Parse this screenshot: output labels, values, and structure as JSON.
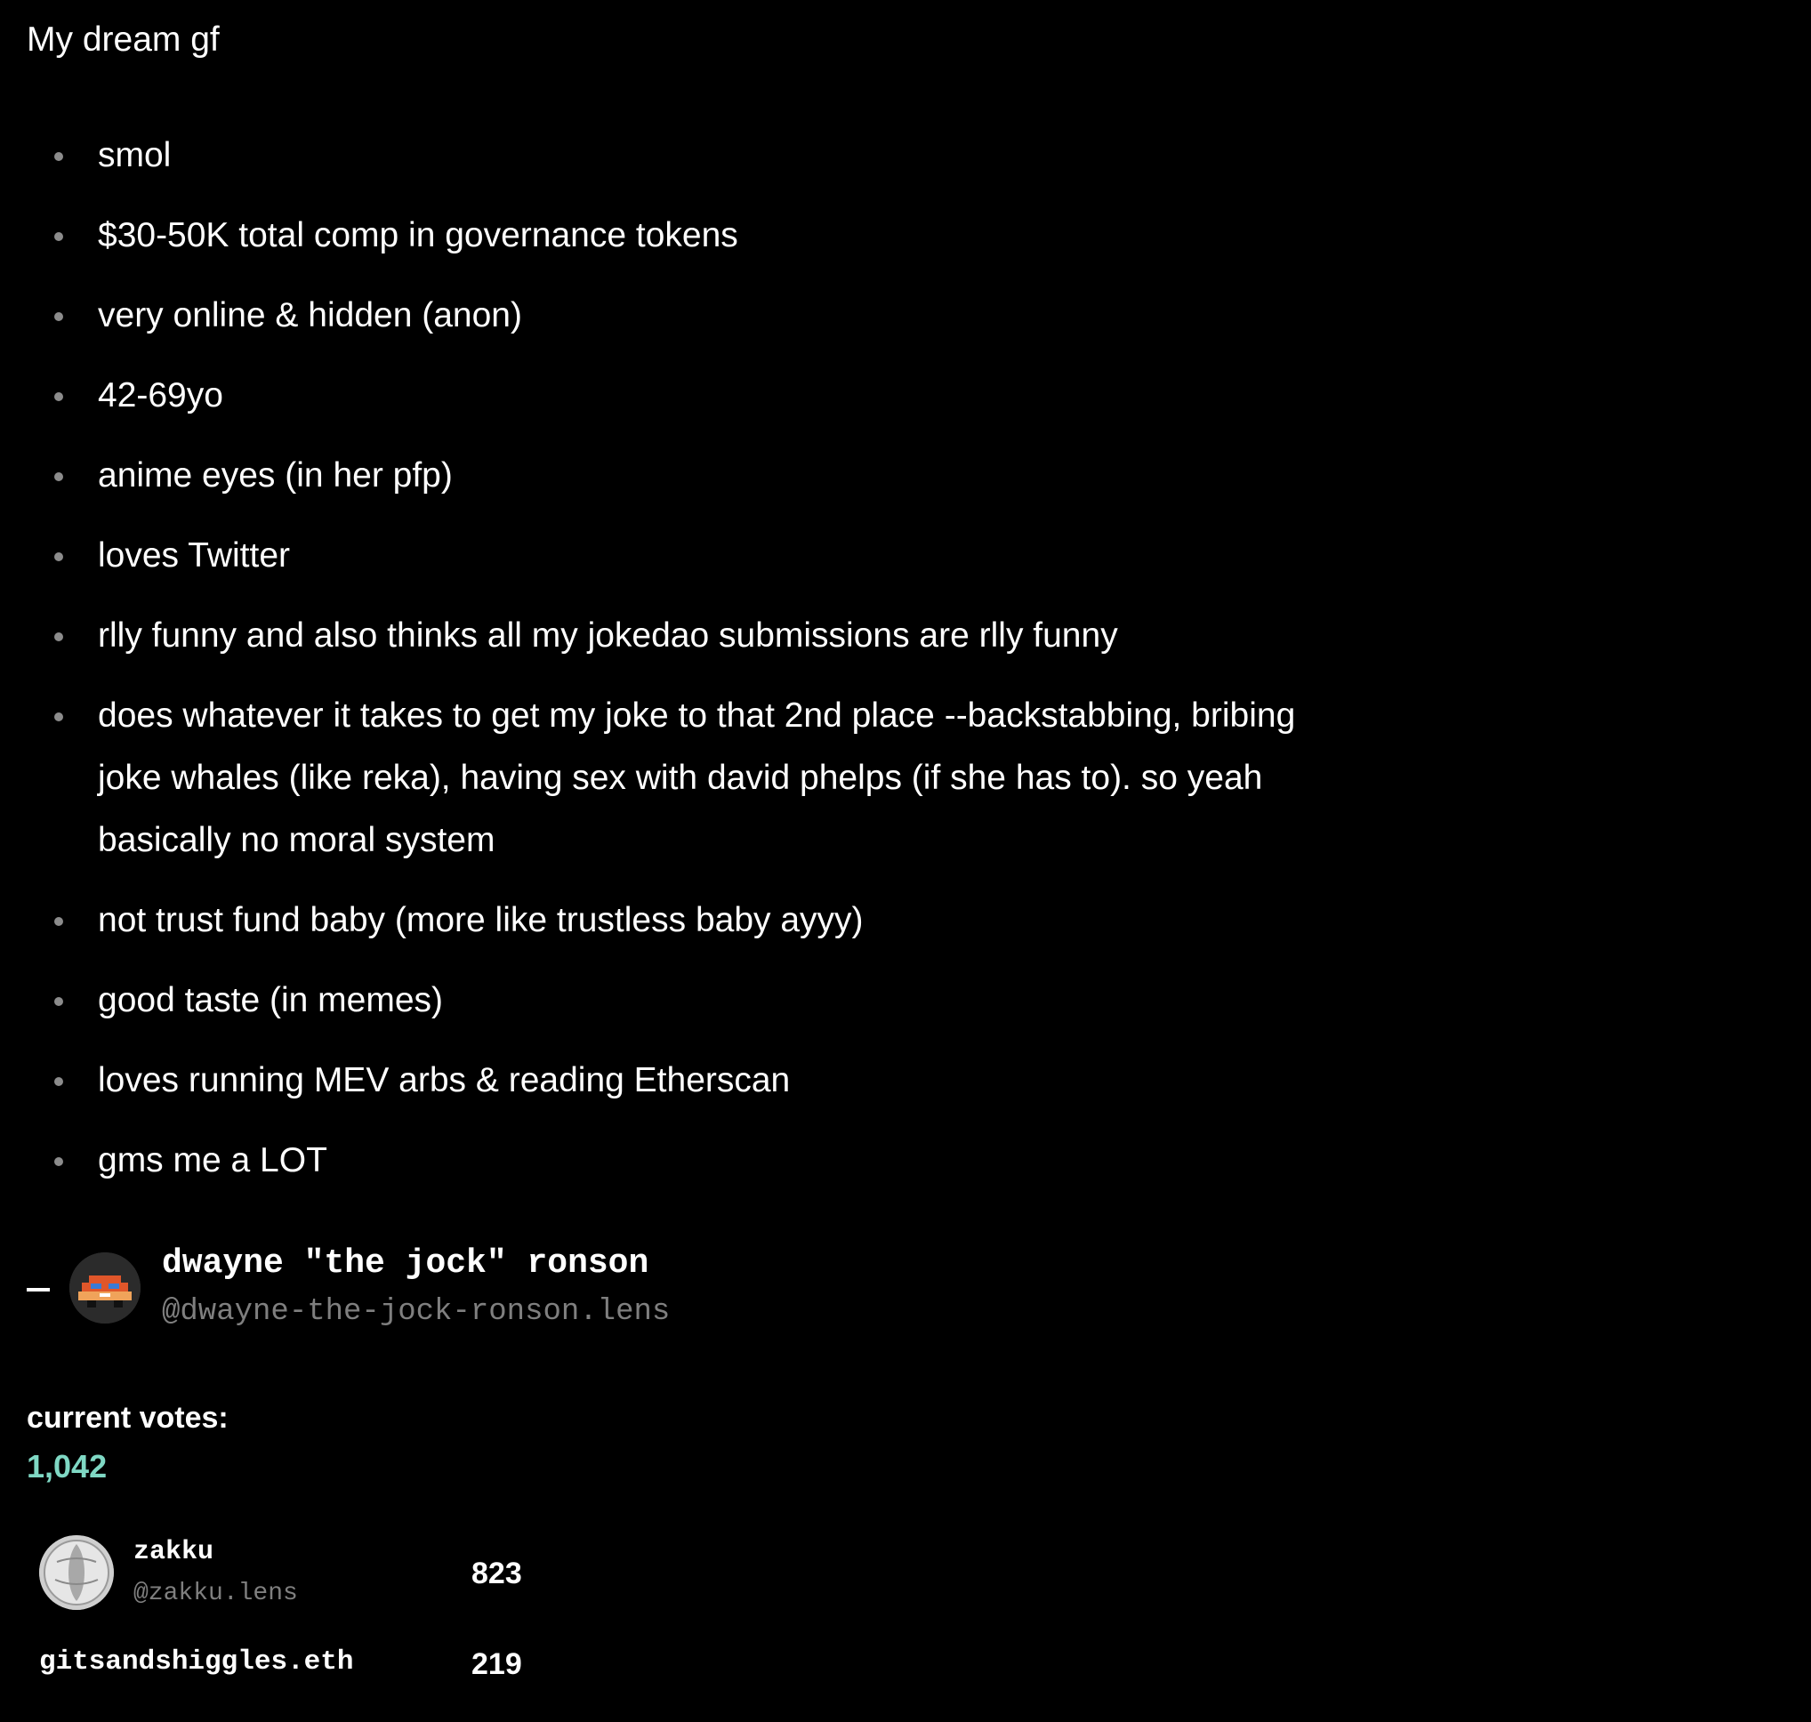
{
  "submission": {
    "title": "My dream gf",
    "items": [
      "smol",
      "$30-50K total comp in governance tokens",
      "very online & hidden (anon)",
      "42-69yo",
      "anime eyes (in her pfp)",
      "loves Twitter",
      "rlly funny and also thinks all my jokedao submissions are rlly funny",
      "does whatever it takes to get my joke to that 2nd place --backstabbing, bribing joke whales (like reka), having sex with david phelps (if she has to). so yeah basically no moral system",
      "not trust fund baby (more like trustless baby ayyy)",
      "good taste (in memes)",
      "loves running MEV arbs & reading Etherscan",
      "gms me a LOT"
    ]
  },
  "author": {
    "name": "dwayne \"the jock\" ronson",
    "handle": "@dwayne-the-jock-ronson.lens",
    "avatar_icon": "pixel-car-avatar"
  },
  "votes": {
    "label": "current votes:",
    "total": "1,042",
    "accent_color": "#7fd8c4",
    "voters": [
      {
        "name": "zakku",
        "handle": "@zakku.lens",
        "votes": "823",
        "avatar_icon": "coin-avatar"
      },
      {
        "name": "gitsandshiggles.eth",
        "votes": "219"
      }
    ]
  }
}
